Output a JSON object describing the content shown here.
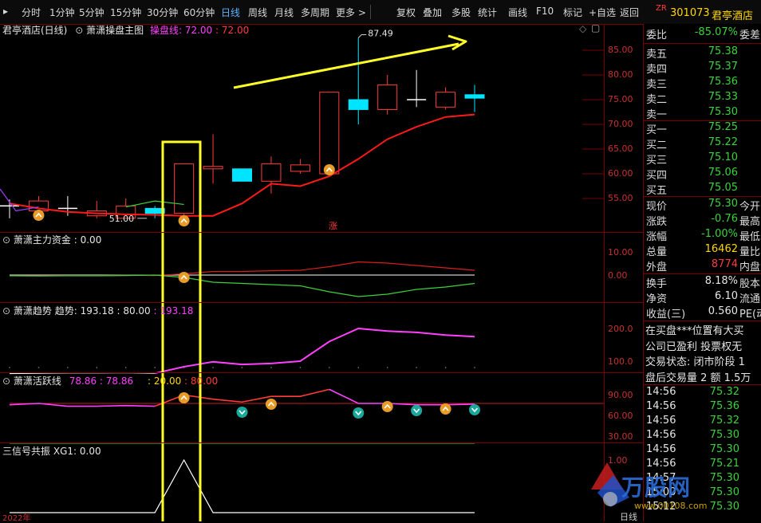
{
  "toolbar": {
    "tabs": [
      "分时",
      "1分钟",
      "5分钟",
      "15分钟",
      "30分钟",
      "60分钟",
      "日线",
      "周线",
      "月线",
      "多周期",
      "更多 >"
    ],
    "active_tab": "日线",
    "tools": [
      "复权",
      "叠加",
      "多股",
      "统计",
      "画线",
      "F10",
      "标记",
      "+自选",
      "返回"
    ]
  },
  "header": {
    "zr_badge": "ZR",
    "stock_code": "301073",
    "stock_name": "君亭酒店"
  },
  "main_chart": {
    "title": "君亭酒店(日线)",
    "indicator": "萧潇操盘主图",
    "line_label": "操盘线:",
    "line_value1": "72.00",
    "line_value2": "72.00",
    "high_marker": "87.49",
    "low_marker": "51.00",
    "zhang_label": "涨",
    "y_ticks": [
      "85.00",
      "80.00",
      "75.00",
      "70.00",
      "65.00",
      "60.00",
      "55.00"
    ]
  },
  "panel2": {
    "title": "萧潇主力资金",
    "value": "0.00",
    "y_ticks": [
      "10.00",
      "0.00"
    ]
  },
  "panel3": {
    "title": "萧潇趋势",
    "label": "趋势:",
    "v1": "193.18",
    "v2": "80.00",
    "v3": "193.18",
    "y_ticks": [
      "200.0",
      "100.0"
    ]
  },
  "panel4": {
    "title": "萧潇活跃线",
    "v1": "78.86",
    "v2": "78.86",
    "v3": "20.00",
    "v4": "80.00",
    "y_ticks": [
      "90.00",
      "60.00",
      "30.00"
    ]
  },
  "panel5": {
    "title": "三信号共振",
    "label": "XG1:",
    "value": "0.00",
    "y_ticks": [
      "1.00"
    ],
    "year_label": "2022年"
  },
  "quote": {
    "webi_label": "委比",
    "webi_value": "-85.07%",
    "wecha_label": "委差",
    "asks": [
      {
        "label": "卖五",
        "price": "75.38"
      },
      {
        "label": "卖四",
        "price": "75.37"
      },
      {
        "label": "卖三",
        "price": "75.36"
      },
      {
        "label": "卖二",
        "price": "75.33"
      },
      {
        "label": "卖一",
        "price": "75.30"
      }
    ],
    "bids": [
      {
        "label": "买一",
        "price": "75.25"
      },
      {
        "label": "买二",
        "price": "75.22"
      },
      {
        "label": "买三",
        "price": "75.10"
      },
      {
        "label": "买四",
        "price": "75.06"
      },
      {
        "label": "买五",
        "price": "75.05"
      }
    ],
    "stats": [
      {
        "label": "现价",
        "value": "75.30",
        "label2": "今开"
      },
      {
        "label": "涨跌",
        "value": "-0.76",
        "label2": "最高"
      },
      {
        "label": "涨幅",
        "value": "-1.00%",
        "label2": "最低"
      },
      {
        "label": "总量",
        "value": "16462",
        "label2": "量比"
      },
      {
        "label": "外盘",
        "value": "8774",
        "label2": "内盘"
      }
    ],
    "stats2": [
      {
        "label": "换手",
        "value": "8.18%",
        "label2": "股本"
      },
      {
        "label": "净资",
        "value": "6.10",
        "label2": "流通"
      },
      {
        "label": "收益(三)",
        "value": "0.560",
        "label2": "PE(动"
      }
    ],
    "notes": [
      "在买盘***位置有大买",
      "公司已盈利 投票权无",
      "交易状态: 闭市阶段 1",
      "盘后交易量 2 额 1.5万"
    ],
    "ticks": [
      {
        "time": "14:56",
        "price": "75.32"
      },
      {
        "time": "14:56",
        "price": "75.36"
      },
      {
        "time": "14:56",
        "price": "75.32"
      },
      {
        "time": "14:56",
        "price": "75.30"
      },
      {
        "time": "14:56",
        "price": "75.30"
      },
      {
        "time": "14:56",
        "price": "75.21"
      },
      {
        "time": "14:57",
        "price": "75.30"
      },
      {
        "time": "15:00",
        "price": "75.30"
      },
      {
        "time": "15:12",
        "price": "75.30"
      }
    ],
    "watermark": "万股网",
    "watermark_url": "www.00108.com",
    "day_label": "日线"
  },
  "chart_data": {
    "type": "candlestick",
    "candles": [
      {
        "o": 53.5,
        "c": 53.5,
        "h": 54.8,
        "l": 51.0,
        "up": false
      },
      {
        "o": 52.5,
        "c": 54.5,
        "h": 55.5,
        "l": 52.0,
        "up": true
      },
      {
        "o": 53.0,
        "c": 53.0,
        "h": 55.5,
        "l": 51.5,
        "up": false
      },
      {
        "o": 51.5,
        "c": 52.5,
        "h": 54.5,
        "l": 51.0,
        "up": true
      },
      {
        "o": 51.0,
        "c": 53.5,
        "h": 55.0,
        "l": 51.0,
        "up": true
      },
      {
        "o": 53.0,
        "c": 52.0,
        "h": 53.5,
        "l": 51.0,
        "up": false
      },
      {
        "o": 52.0,
        "c": 62.0,
        "h": 62.0,
        "l": 51.5,
        "up": true
      },
      {
        "o": 61.5,
        "c": 61.0,
        "h": 68.0,
        "l": 58.0,
        "up": true
      },
      {
        "o": 61.0,
        "c": 58.5,
        "h": 61.0,
        "l": 58.5,
        "up": false
      },
      {
        "o": 58.5,
        "c": 62.0,
        "h": 63.5,
        "l": 56.0,
        "up": true
      },
      {
        "o": 60.5,
        "c": 61.8,
        "h": 63.0,
        "l": 60.0,
        "up": true
      },
      {
        "o": 60.0,
        "c": 76.5,
        "h": 76.5,
        "l": 60.0,
        "up": true
      },
      {
        "o": 73.0,
        "c": 75.0,
        "h": 87.5,
        "l": 70.0,
        "up": false
      },
      {
        "o": 73.0,
        "c": 78.0,
        "h": 80.0,
        "l": 72.0,
        "up": true
      },
      {
        "o": 75.0,
        "c": 75.0,
        "h": 81.0,
        "l": 73.5,
        "up": false
      },
      {
        "o": 73.5,
        "c": 76.5,
        "h": 77.5,
        "l": 73.0,
        "up": true
      },
      {
        "o": 76.0,
        "c": 75.3,
        "h": 78.0,
        "l": 72.5,
        "up": false
      }
    ],
    "operation_line": [
      54.0,
      53.0,
      52.3,
      52.0,
      51.8,
      51.7,
      51.5,
      51.5,
      54.0,
      58.0,
      57.5,
      59.5,
      63.0,
      67.0,
      69.5,
      71.5,
      72.0
    ],
    "main_force": [
      -0.3,
      -0.3,
      -0.2,
      -0.2,
      -0.1,
      -0.2,
      0.5,
      1.5,
      1.5,
      1.8,
      2.0,
      3.5,
      5.5,
      5.0,
      4.0,
      3.0,
      2.0
    ],
    "main_force_neg": [
      -0.3,
      -0.4,
      -0.3,
      -0.3,
      -0.2,
      0.0,
      -1.0,
      -3.0,
      -3.5,
      -4.0,
      -4.5,
      -7.0,
      -9.0,
      -8.0,
      -6.0,
      -5.0,
      -3.5
    ],
    "trend": [
      62.0,
      63.0,
      64.0,
      64.0,
      64.5,
      63.0,
      83.0,
      98.0,
      90.0,
      93.0,
      100.0,
      160.0,
      200.0,
      192.0,
      188.0,
      180.0,
      175.0
    ],
    "active_line": [
      78.0,
      80.0,
      76.0,
      76.0,
      77.0,
      76.0,
      92.0,
      86.0,
      82.0,
      90.0,
      90.0,
      100.0,
      80.0,
      80.0,
      78.0,
      78.0,
      78.9
    ],
    "xg1": [
      0,
      0,
      0,
      0,
      0,
      0,
      1,
      0,
      0,
      0,
      0,
      0,
      0,
      0,
      0,
      0,
      0
    ]
  }
}
